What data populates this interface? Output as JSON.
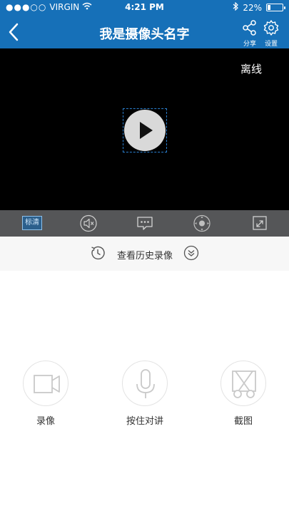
{
  "status_bar": {
    "signal_dots": "●●●○○",
    "carrier": "VIRGIN",
    "time": "4:21 PM",
    "battery_percent": "22%",
    "battery_level": 0.22
  },
  "nav": {
    "title": "我是摄像头名字",
    "share_label": "分享",
    "settings_label": "设置"
  },
  "video": {
    "offline_label": "离线"
  },
  "controls": {
    "quality_label": "标清"
  },
  "history": {
    "label": "查看历史录像"
  },
  "actions": {
    "record_label": "录像",
    "talk_label": "按住对讲",
    "screenshot_label": "截图"
  },
  "colors": {
    "nav_bg": "#1670b8",
    "controls_bg": "#555658",
    "history_bg": "#f7f7f7",
    "video_bg": "#000000"
  },
  "icons": [
    "back-icon",
    "wifi-icon",
    "bluetooth-icon",
    "share-icon",
    "gear-icon",
    "play-icon",
    "speaker-muted-icon",
    "chat-icon",
    "ptz-icon",
    "fullscreen-icon",
    "history-clock-icon",
    "chevron-double-down-icon",
    "video-camera-icon",
    "microphone-icon",
    "scissors-icon"
  ]
}
